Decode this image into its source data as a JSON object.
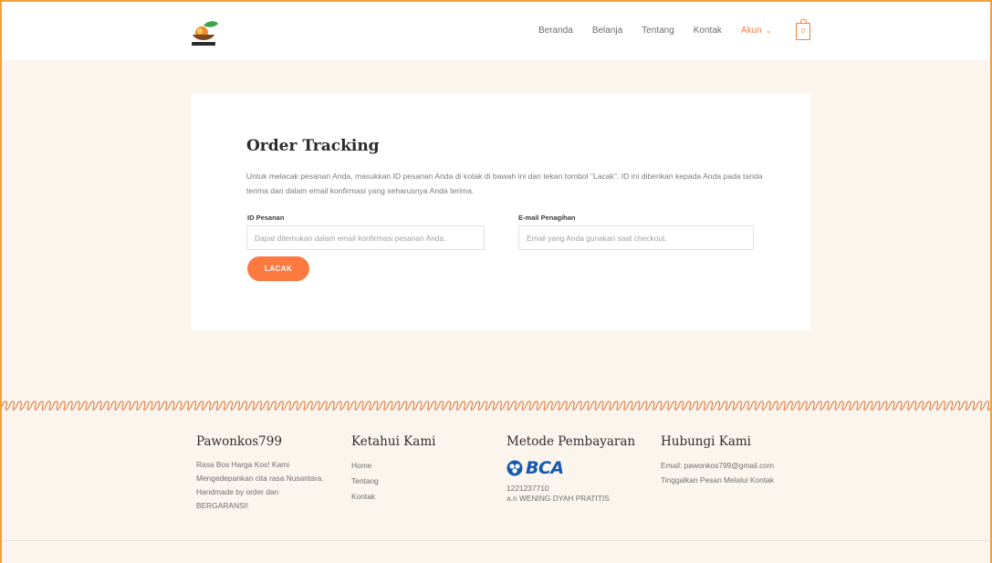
{
  "nav": {
    "items": [
      {
        "label": "Beranda"
      },
      {
        "label": "Belanja"
      },
      {
        "label": "Tentang"
      },
      {
        "label": "Kontak"
      }
    ],
    "account_label": "Akun",
    "cart_count": "0"
  },
  "tracking": {
    "title": "Order Tracking",
    "description": "Untuk melacak pesanan Anda, masukkan ID pesanan Anda di kotak di bawah ini dan tekan tombol \"Lacak\". ID ini diberikan kepada Anda pada tanda terima dan dalam email konfirmasi yang seharusnya Anda terima.",
    "order_id_label": "ID Pesanan",
    "order_id_placeholder": "Dapat ditemukan dalam email konfirmasi pesanan Anda.",
    "email_label": "E-mail Penagihan",
    "email_placeholder": "Email yang Anda gunakan saat checkout.",
    "submit_label": "LACAK"
  },
  "footer": {
    "about": {
      "title": "Pawonkos799",
      "text": "Rasa Bos Harga Kos! Kami Mengedepankan cita rasa Nusantara. Handmade by order dan BERGARANSI!"
    },
    "links": {
      "title": "Ketahui Kami",
      "items": [
        "Home",
        "Tentang",
        "Kontak"
      ]
    },
    "payment": {
      "title": "Metode Pembayaran",
      "bank_name": "BCA",
      "account_number": "1221237710",
      "account_holder": "a.n WENING DYAH PRATITIS"
    },
    "contact": {
      "title": "Hubungi Kami",
      "email": "Email: pawonkos799@gmail.com",
      "message": "Tinggalkan Pesan Melalui Kontak"
    }
  },
  "colors": {
    "accent": "#fc7a3f",
    "frame": "#f1a13a",
    "background": "#fbf5ee",
    "bca_blue": "#1559b0"
  }
}
